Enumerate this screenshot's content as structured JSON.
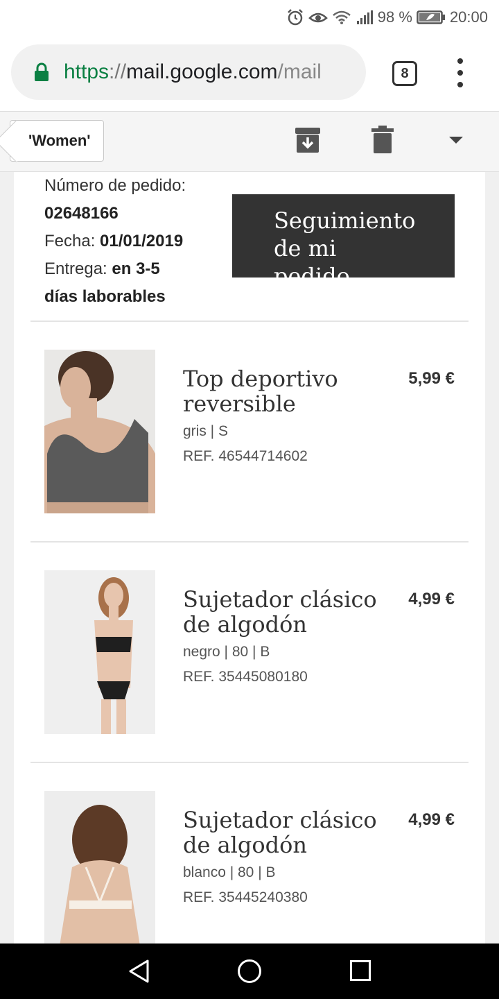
{
  "status": {
    "battery": "98 %",
    "time": "20:00"
  },
  "browser": {
    "url_scheme": "https",
    "url_sep": "://",
    "url_host": "mail.google.com",
    "url_path": "/mail",
    "tab_count": "8"
  },
  "toolbar": {
    "label": "'Women'"
  },
  "order": {
    "number_label": "Número de pedido:",
    "number": "02648166",
    "date_label": "Fecha:",
    "date": "01/01/2019",
    "delivery_label": "Entrega:",
    "delivery_line1": "en 3-5",
    "delivery_line2": "días laborables",
    "track_button": "Seguimiento de mi pedido"
  },
  "products": [
    {
      "name": "Top deportivo reversible",
      "price": "5,99 €",
      "variant": "gris | S",
      "ref": "REF. 46544714602"
    },
    {
      "name": "Sujetador clásico de algodón",
      "price": "4,99 €",
      "variant": "negro | 80 | B",
      "ref": "REF. 35445080180"
    },
    {
      "name": "Sujetador clásico de algodón",
      "price": "4,99 €",
      "variant": "blanco | 80 | B",
      "ref": "REF. 35445240380"
    }
  ],
  "colors": {
    "url_green": "#0b8043",
    "button_dark": "#333333",
    "nav_bar": "#000000"
  }
}
